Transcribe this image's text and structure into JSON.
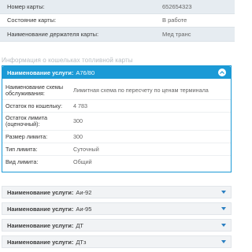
{
  "card": {
    "rows": [
      {
        "label": "Номер карты:",
        "value": "652654323"
      },
      {
        "label": "Состояние карты:",
        "value": "В работе"
      },
      {
        "label": "Наименование держателя карты:",
        "value": "Мед транс"
      }
    ]
  },
  "wallets": {
    "title": "Информация о кошельках топливной карты",
    "open_item": {
      "prefix": "Наименование услуги:",
      "service": "А76/80",
      "details": [
        {
          "label": "Наименование схемы обслуживания:",
          "value": "Лимитная схема по пересчету по ценам терминала"
        },
        {
          "label": "Остаток по кошельку:",
          "value": "4 783"
        },
        {
          "label": "Остаток лимита (оценочный):",
          "value": "300"
        },
        {
          "label": "Размер лимита:",
          "value": "300"
        },
        {
          "label": "Тип лимита:",
          "value": "Суточный"
        },
        {
          "label": "Вид лимита:",
          "value": "Общий"
        }
      ]
    },
    "closed_items": [
      {
        "prefix": "Наименование услуги:",
        "service": "Аи-92"
      },
      {
        "prefix": "Наименование услуги:",
        "service": "Аи-95"
      },
      {
        "prefix": "Наименование услуги:",
        "service": "ДТ"
      },
      {
        "prefix": "Наименование услуги:",
        "service": "ДТз"
      }
    ],
    "icons": {
      "expanded": "chevron-up-icon",
      "collapsed": "caret-down-icon"
    },
    "colors": {
      "accent": "#1b9ad6",
      "header_bg": "#f1f3f5"
    }
  }
}
